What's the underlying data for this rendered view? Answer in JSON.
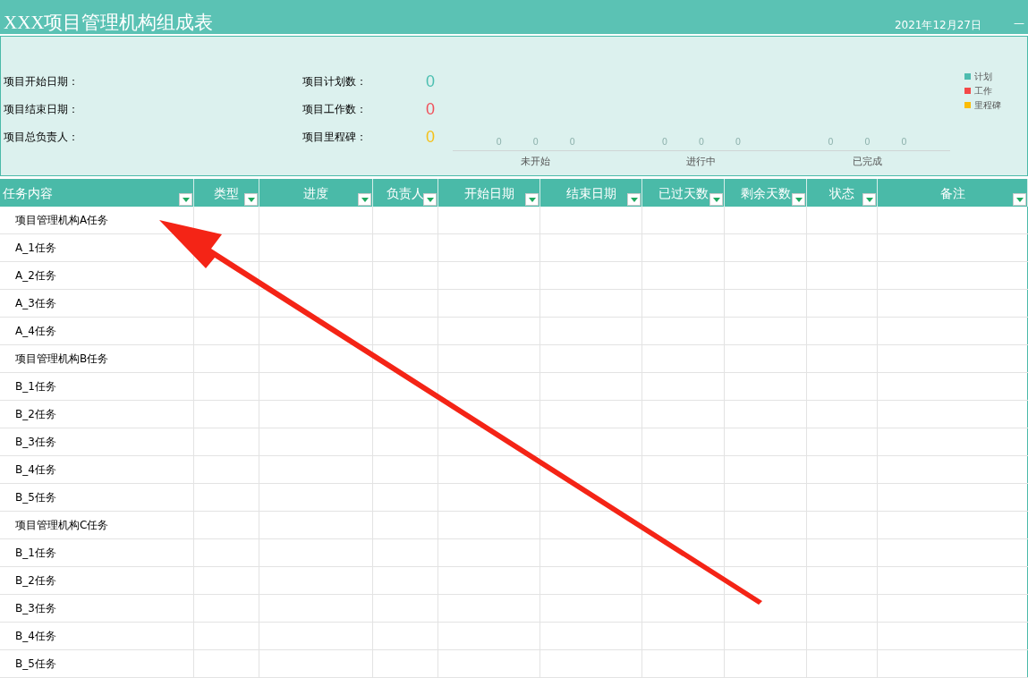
{
  "title": "XXX项目管理机构组成表",
  "date": "2021年12月27日",
  "corner_mark": "—",
  "summary": {
    "fields": [
      {
        "label": "项目开始日期："
      },
      {
        "label": "项目结束日期："
      },
      {
        "label": "项目总负责人："
      }
    ],
    "counts": [
      {
        "label": "项目计划数：",
        "value": "0",
        "color": "#4bbfb0"
      },
      {
        "label": "项目工作数：",
        "value": "0",
        "color": "#f0505a"
      },
      {
        "label": "项目里程碑：",
        "value": "0",
        "color": "#f5c018"
      }
    ]
  },
  "chart": {
    "groups": [
      {
        "label": "未开始",
        "values": [
          "0",
          "0",
          "0"
        ]
      },
      {
        "label": "进行中",
        "values": [
          "0",
          "0",
          "0"
        ]
      },
      {
        "label": "已完成",
        "values": [
          "0",
          "0",
          "0"
        ]
      }
    ],
    "legend": [
      {
        "name": "计划",
        "color": "#4dbcaf"
      },
      {
        "name": "工作",
        "color": "#f44848"
      },
      {
        "name": "里程碑",
        "color": "#fbbd05"
      }
    ]
  },
  "table": {
    "columns": [
      {
        "label": "任务内容"
      },
      {
        "label": "类型"
      },
      {
        "label": "进度"
      },
      {
        "label": "负责人"
      },
      {
        "label": "开始日期"
      },
      {
        "label": "结束日期"
      },
      {
        "label": "已过天数"
      },
      {
        "label": "剩余天数"
      },
      {
        "label": "状态"
      },
      {
        "label": "备注"
      }
    ],
    "rows": [
      {
        "task": "项目管理机构A任务"
      },
      {
        "task": "A_1任务"
      },
      {
        "task": "A_2任务"
      },
      {
        "task": "A_3任务"
      },
      {
        "task": "A_4任务"
      },
      {
        "task": "项目管理机构B任务"
      },
      {
        "task": "B_1任务"
      },
      {
        "task": "B_2任务"
      },
      {
        "task": "B_3任务"
      },
      {
        "task": "B_4任务"
      },
      {
        "task": "B_5任务"
      },
      {
        "task": "项目管理机构C任务"
      },
      {
        "task": "B_1任务"
      },
      {
        "task": "B_2任务"
      },
      {
        "task": "B_3任务"
      },
      {
        "task": "B_4任务"
      },
      {
        "task": "B_5任务"
      }
    ]
  }
}
